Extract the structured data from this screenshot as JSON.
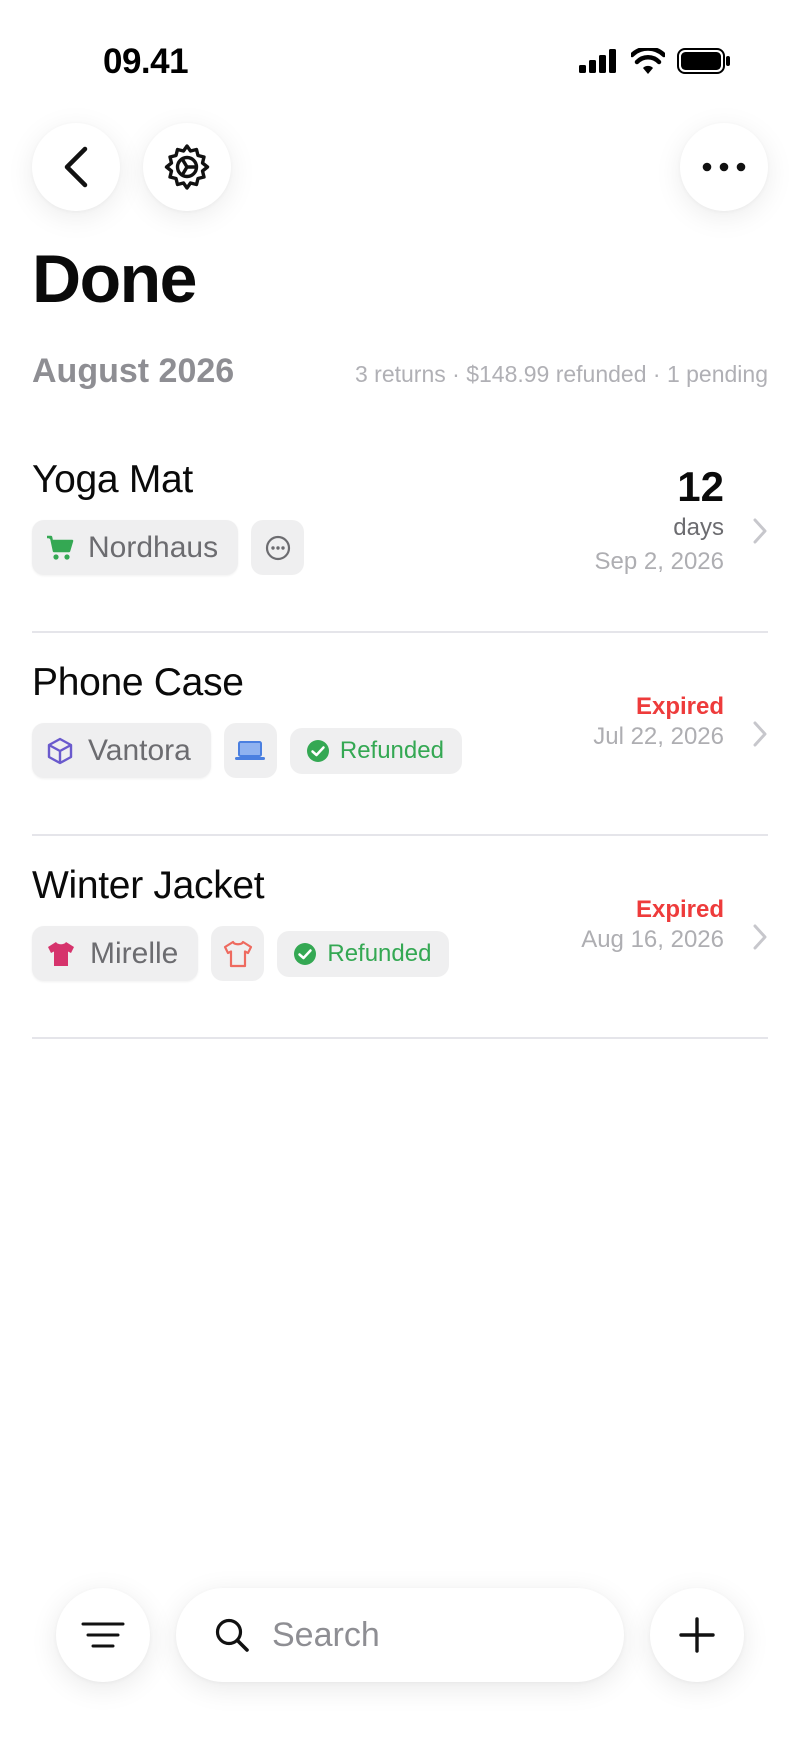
{
  "status_bar": {
    "time": "09.41"
  },
  "header": {
    "title": "Done"
  },
  "section": {
    "month": "August 2026",
    "summary": "3 returns · $148.99 refunded · 1 pending"
  },
  "items": [
    {
      "title": "Yoga Mat",
      "store": "Nordhaus",
      "store_icon": "cart-icon",
      "category_icon": "more-circle-icon",
      "status": "",
      "days": "12",
      "days_unit": "days",
      "date": "Sep 2, 2026"
    },
    {
      "title": "Phone Case",
      "store": "Vantora",
      "store_icon": "box-icon",
      "category_icon": "laptop-icon",
      "status": "Refunded",
      "expired_label": "Expired",
      "date": "Jul 22, 2026"
    },
    {
      "title": "Winter Jacket",
      "store": "Mirelle",
      "store_icon": "shirt-icon",
      "category_icon": "shirt-outline-icon",
      "status": "Refunded",
      "expired_label": "Expired",
      "date": "Aug 16, 2026"
    }
  ],
  "bottom_bar": {
    "search_placeholder": "Search"
  },
  "colors": {
    "expired": "#ee3b3b",
    "refunded": "#34a853",
    "cart": "#34a853",
    "box": "#6a5acd",
    "laptop": "#4a7fe0",
    "shirt": "#d6336c",
    "shirt_outline": "#ee6a5f"
  }
}
